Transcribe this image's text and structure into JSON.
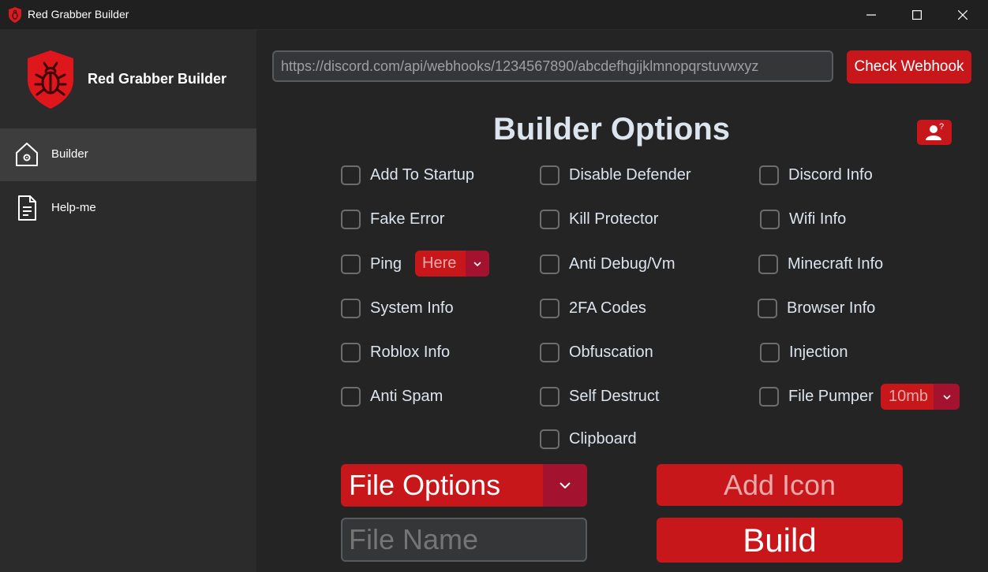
{
  "window": {
    "title": "Red Grabber Builder",
    "controls": [
      "minimize",
      "maximize",
      "close"
    ]
  },
  "sidebar": {
    "brand": "Red Grabber Builder",
    "logo_icon": "shield-bug-icon",
    "items": [
      {
        "label": "Builder",
        "icon": "home-gear-icon",
        "active": true
      },
      {
        "label": "Help-me",
        "icon": "document-icon",
        "active": false
      }
    ]
  },
  "webhook": {
    "value": "https://discord.com/api/webhooks/1234567890/abcdefhgijklmnopqrstuvwxyz"
  },
  "check_button": "Check Webhook",
  "heading": "Builder Options",
  "help_icon": "user-question-icon",
  "options": {
    "col1": [
      "Add To Startup",
      "Fake Error",
      "Ping",
      "System Info",
      "Roblox Info",
      "Anti Spam"
    ],
    "col2": [
      "Disable Defender",
      "Kill Protector",
      "Anti Debug/Vm",
      "2FA Codes",
      "Obfuscation",
      "Self Destruct",
      "Clipboard"
    ],
    "col3": [
      "Discord Info",
      "Wifi Info",
      "Minecraft Info",
      "Browser Info",
      "Injection",
      "File Pumper"
    ]
  },
  "ping_dropdown": {
    "value": "Here"
  },
  "pumper_dropdown": {
    "value": "10mb"
  },
  "file_options": {
    "value": "File Options"
  },
  "add_icon_button": "Add Icon",
  "file_name": {
    "placeholder": "File Name"
  },
  "build_button": "Build",
  "colors": {
    "accent": "#c8171b",
    "accent_dark": "#a3132f",
    "background": "#242424",
    "sidebar": "#2b2b2b"
  }
}
